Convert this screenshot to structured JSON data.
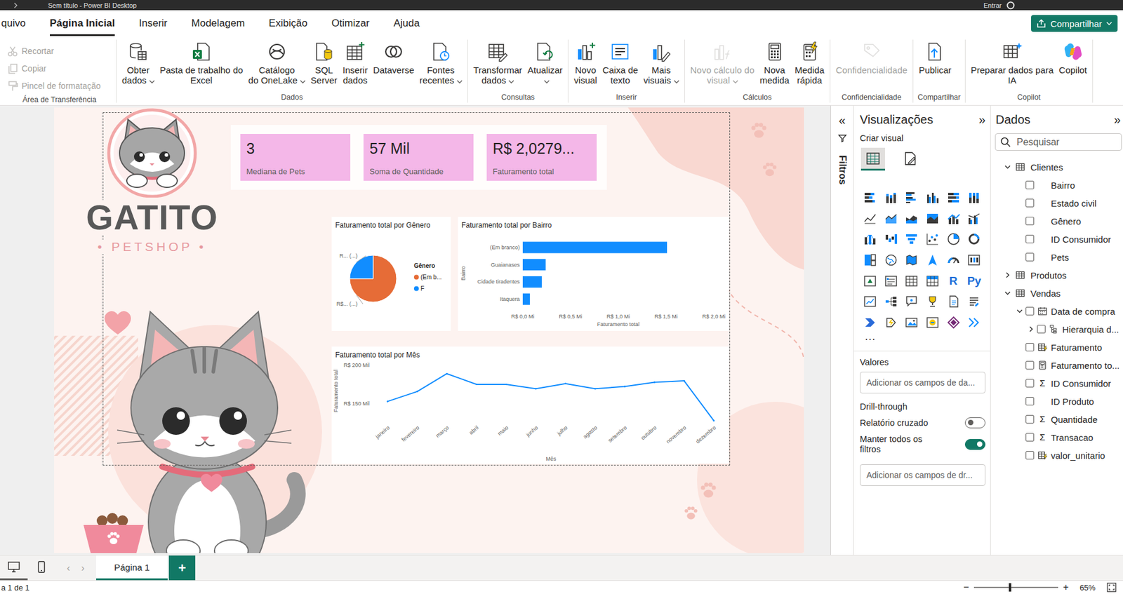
{
  "window": {
    "title": "Sem título - Power BI Desktop",
    "signin": "Entrar"
  },
  "menu": [
    {
      "label": "quivo",
      "selected": false
    },
    {
      "label": "Página Inicial",
      "selected": true
    },
    {
      "label": "Inserir",
      "selected": false
    },
    {
      "label": "Modelagem",
      "selected": false
    },
    {
      "label": "Exibição",
      "selected": false
    },
    {
      "label": "Otimizar",
      "selected": false
    },
    {
      "label": "Ajuda",
      "selected": false
    }
  ],
  "share": {
    "label": "Compartilhar",
    "dropdown": true
  },
  "ribbon": {
    "groups": [
      {
        "label": "Área de Transferência",
        "kind": "small",
        "buttons": [
          {
            "lines": [
              "Recortar"
            ],
            "kind": "cut",
            "disabled": true,
            "dropdown": false
          },
          {
            "lines": [
              "Copiar"
            ],
            "kind": "copy",
            "disabled": true,
            "dropdown": false
          },
          {
            "lines": [
              "Pincel de formatação"
            ],
            "kind": "format-painter",
            "disabled": true,
            "dropdown": false
          }
        ]
      },
      {
        "label": "Dados",
        "kind": "large",
        "buttons": [
          {
            "lines": [
              "Obter",
              "dados"
            ],
            "kind": "get-data",
            "disabled": false,
            "dropdown": true
          },
          {
            "lines": [
              "Pasta de trabalho do",
              "Excel"
            ],
            "kind": "excel",
            "disabled": false,
            "dropdown": false
          },
          {
            "lines": [
              "Catálogo",
              "do OneLake"
            ],
            "kind": "onelake",
            "disabled": false,
            "dropdown": true
          },
          {
            "lines": [
              "SQL",
              "Server"
            ],
            "kind": "sql",
            "disabled": false,
            "dropdown": false
          },
          {
            "lines": [
              "Inserir",
              "dados"
            ],
            "kind": "insert-data",
            "disabled": false,
            "dropdown": false
          },
          {
            "lines": [
              "Dataverse"
            ],
            "kind": "dataverse",
            "disabled": false,
            "dropdown": false
          },
          {
            "lines": [
              "Fontes",
              "recentes"
            ],
            "kind": "recent",
            "disabled": false,
            "dropdown": true
          }
        ]
      },
      {
        "label": "Consultas",
        "kind": "large",
        "buttons": [
          {
            "lines": [
              "Transformar",
              "dados"
            ],
            "kind": "transform",
            "disabled": false,
            "dropdown": true
          },
          {
            "lines": [
              "Atualizar"
            ],
            "kind": "refresh",
            "disabled": false,
            "dropdown": true
          }
        ]
      },
      {
        "label": "Inserir",
        "kind": "large",
        "buttons": [
          {
            "lines": [
              "Novo",
              "visual"
            ],
            "kind": "new-visual",
            "disabled": false,
            "dropdown": false
          },
          {
            "lines": [
              "Caixa de",
              "texto"
            ],
            "kind": "text-box",
            "disabled": false,
            "dropdown": false
          },
          {
            "lines": [
              "Mais",
              "visuais"
            ],
            "kind": "more-visuals",
            "disabled": false,
            "dropdown": true
          }
        ]
      },
      {
        "label": "Cálculos",
        "kind": "large",
        "buttons": [
          {
            "lines": [
              "Novo cálculo do",
              "visual"
            ],
            "kind": "visual-calc",
            "disabled": true,
            "dropdown": true
          },
          {
            "lines": [
              "Nova",
              "medida"
            ],
            "kind": "measure",
            "disabled": false,
            "dropdown": false
          },
          {
            "lines": [
              "Medida",
              "rápida"
            ],
            "kind": "quick-measure",
            "disabled": false,
            "dropdown": false
          }
        ]
      },
      {
        "label": "Confidencialidade",
        "kind": "large",
        "buttons": [
          {
            "lines": [
              "Confidencialidade"
            ],
            "kind": "sensitivity",
            "disabled": true,
            "dropdown": false
          }
        ]
      },
      {
        "label": "Compartilhar",
        "kind": "large",
        "buttons": [
          {
            "lines": [
              "Publicar"
            ],
            "kind": "publish",
            "disabled": false,
            "dropdown": false
          }
        ]
      },
      {
        "label": "Copilot",
        "kind": "large",
        "buttons": [
          {
            "lines": [
              "Preparar dados para",
              "IA"
            ],
            "kind": "prepare-ai",
            "disabled": false,
            "dropdown": false
          },
          {
            "lines": [
              "Copilot"
            ],
            "kind": "copilot",
            "disabled": false,
            "dropdown": false
          }
        ]
      }
    ]
  },
  "report": {
    "logo": {
      "name": "GATITO",
      "tagline": "• PETSHOP •"
    },
    "cards": [
      {
        "value": "3",
        "label": "Mediana de Pets"
      },
      {
        "value": "57 Mil",
        "label": "Soma de Quantidade"
      },
      {
        "value": "R$ 2,0279...",
        "label": "Faturamento total"
      }
    ],
    "pie": {
      "title": "Faturamento total por Gênero",
      "legend_title": "Gênero",
      "slices": [
        {
          "label": "(Em b...",
          "value": 75,
          "color": "#E66C37",
          "data_label": "R$... (...)"
        },
        {
          "label": "F",
          "value": 25,
          "color": "#118DFF",
          "data_label": "R... (...)"
        }
      ]
    },
    "bar": {
      "title": "Faturamento total por Bairro",
      "y_title": "Bairro",
      "x_title": "Faturamento total",
      "ticks": [
        {
          "label": "R$ 0,0 Mi",
          "value": 0
        },
        {
          "label": "R$ 0,5 Mi",
          "value": 0.5
        },
        {
          "label": "R$ 1,0 Mi",
          "value": 1.0
        },
        {
          "label": "R$ 1,5 Mi",
          "value": 1.5
        },
        {
          "label": "R$ 2,0 Mi",
          "value": 2.0
        }
      ],
      "bars": [
        {
          "label": "(Em branco)",
          "value": 1.51
        },
        {
          "label": "Guaianases",
          "value": 0.24
        },
        {
          "label": "Cidade tiradentes",
          "value": 0.2
        },
        {
          "label": "Itaquera",
          "value": 0.075
        }
      ]
    },
    "line": {
      "title": "Faturamento total por Mês",
      "y_title": "Faturamento total",
      "x_title": "Mês",
      "y_ticks": [
        {
          "label": "R$ 200 Mil",
          "value": 200
        },
        {
          "label": "R$ 150 Mil",
          "value": 150
        }
      ],
      "months": [
        "janeiro",
        "fevereiro",
        "março",
        "abril",
        "maio",
        "junho",
        "julho",
        "agosto",
        "setembro",
        "outubro",
        "novembro",
        "dezembro"
      ],
      "values": [
        152.8,
        165.7,
        188.9,
        175,
        175,
        169.4,
        175.9,
        169.4,
        172.2,
        177.8,
        179.6,
        127.8
      ]
    }
  },
  "filters": {
    "expand": "«",
    "label": "Filtros"
  },
  "viz": {
    "title": "Visualizações",
    "collapse": "»",
    "subtitle": "Criar visual",
    "build_tabs": [
      {
        "selected": true
      },
      {
        "selected": false
      }
    ],
    "gallery": [
      {
        "kind": "bar-h-stacked"
      },
      {
        "kind": "bar-v-stacked"
      },
      {
        "kind": "bar-h-clustered"
      },
      {
        "kind": "bar-v-clustered"
      },
      {
        "kind": "bar-h-100"
      },
      {
        "kind": "bar-v-100"
      },
      {
        "kind": "line"
      },
      {
        "kind": "area"
      },
      {
        "kind": "area-stacked"
      },
      {
        "kind": "area-100"
      },
      {
        "kind": "line-col"
      },
      {
        "kind": "line-col-clustered"
      },
      {
        "kind": "ribbon"
      },
      {
        "kind": "waterfall"
      },
      {
        "kind": "funnel"
      },
      {
        "kind": "scatter"
      },
      {
        "kind": "pie"
      },
      {
        "kind": "donut"
      },
      {
        "kind": "treemap"
      },
      {
        "kind": "map"
      },
      {
        "kind": "filled-map"
      },
      {
        "kind": "azure-map"
      },
      {
        "kind": "gauge"
      },
      {
        "kind": "card"
      },
      {
        "kind": "kpi"
      },
      {
        "kind": "slicer"
      },
      {
        "kind": "table"
      },
      {
        "kind": "matrix"
      },
      {
        "kind": "glyph",
        "label": "R"
      },
      {
        "kind": "glyph",
        "label": "Py"
      },
      {
        "kind": "influencers"
      },
      {
        "kind": "decomp"
      },
      {
        "kind": "qa"
      },
      {
        "kind": "goals"
      },
      {
        "kind": "paginated"
      },
      {
        "kind": "narrative"
      },
      {
        "kind": "automate"
      },
      {
        "kind": "automate-alt"
      },
      {
        "kind": "image"
      },
      {
        "kind": "arcgis"
      },
      {
        "kind": "powerapps"
      },
      {
        "kind": "button"
      }
    ],
    "more": "···",
    "values_label": "Valores",
    "values_placeholder": "Adicionar os campos de da...",
    "drill_title": "Drill-through",
    "toggles": [
      {
        "label": "Relatório cruzado",
        "on": false
      },
      {
        "label": "Manter todos os filtros",
        "on": true
      }
    ],
    "drill_placeholder": "Adicionar os campos de dr..."
  },
  "data": {
    "title": "Dados",
    "collapse": "»",
    "search": {
      "placeholder": "Pesquisar"
    },
    "tables": [
      {
        "name": "Clientes",
        "expanded": true,
        "fields": [
          {
            "name": "Bairro",
            "kind": "text",
            "checked": false
          },
          {
            "name": "Estado civil",
            "kind": "text",
            "checked": false
          },
          {
            "name": "Gênero",
            "kind": "text",
            "checked": false
          },
          {
            "name": "ID Consumidor",
            "kind": "text",
            "checked": false
          },
          {
            "name": "Pets",
            "kind": "text",
            "checked": false
          }
        ]
      },
      {
        "name": "Produtos",
        "expanded": false,
        "fields": []
      },
      {
        "name": "Vendas",
        "expanded": true,
        "fields": [
          {
            "name": "Data de compra",
            "kind": "date",
            "checked": false,
            "expanded": true,
            "children": [
              {
                "name": "Hierarquia d...",
                "kind": "hierarchy",
                "checked": false,
                "expanded": false
              }
            ]
          },
          {
            "name": "Faturamento",
            "kind": "calc-column",
            "checked": false
          },
          {
            "name": "Faturamento to...",
            "kind": "measure",
            "checked": false
          },
          {
            "name": "ID Consumidor",
            "kind": "sum",
            "glyph": "Σ",
            "checked": false
          },
          {
            "name": "ID Produto",
            "kind": "text",
            "checked": false
          },
          {
            "name": "Quantidade",
            "kind": "sum",
            "glyph": "Σ",
            "checked": false
          },
          {
            "name": "Transacao",
            "kind": "sum",
            "glyph": "Σ",
            "checked": false
          },
          {
            "name": "valor_unitario",
            "kind": "calc-column",
            "checked": false
          }
        ]
      }
    ]
  },
  "page_bar": {
    "views": [
      {
        "kind": "desktop",
        "selected": true
      },
      {
        "kind": "mobile",
        "selected": false
      }
    ],
    "nav": [
      "‹",
      "›"
    ],
    "pages": [
      {
        "label": "Página 1",
        "selected": true
      }
    ],
    "add": "+"
  },
  "status": {
    "page_info": "a 1 de 1",
    "zoom": {
      "minus": "−",
      "plus": "+",
      "reading": "65%",
      "level": 0.43
    }
  }
}
